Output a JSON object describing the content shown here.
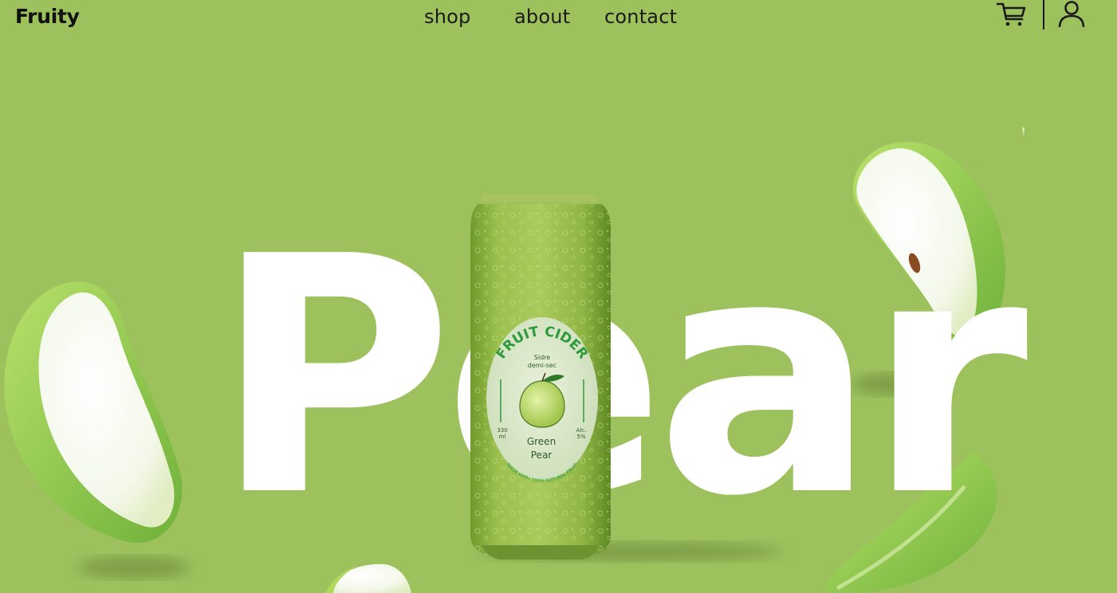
{
  "brand": {
    "name": "Fruity"
  },
  "nav": {
    "items": [
      {
        "label": "shop"
      },
      {
        "label": "about"
      },
      {
        "label": "contact"
      }
    ]
  },
  "header_icons": {
    "cart": "cart-icon",
    "user": "user-icon"
  },
  "hero": {
    "word": "Pear",
    "background_color": "#9dc15d"
  },
  "can": {
    "arc_title": "FRUIT CIDER",
    "subtitle_line1": "Sidre",
    "subtitle_line2": "demi-sec",
    "volume_line1": "330",
    "volume_line2": "ml",
    "alcohol_line1": "Alc.",
    "alcohol_line2": "5%",
    "flavor_line1": "Green",
    "flavor_line2": "Pear",
    "bottom_arc": "MADE WITH 100% NATURAL FRUIT"
  }
}
